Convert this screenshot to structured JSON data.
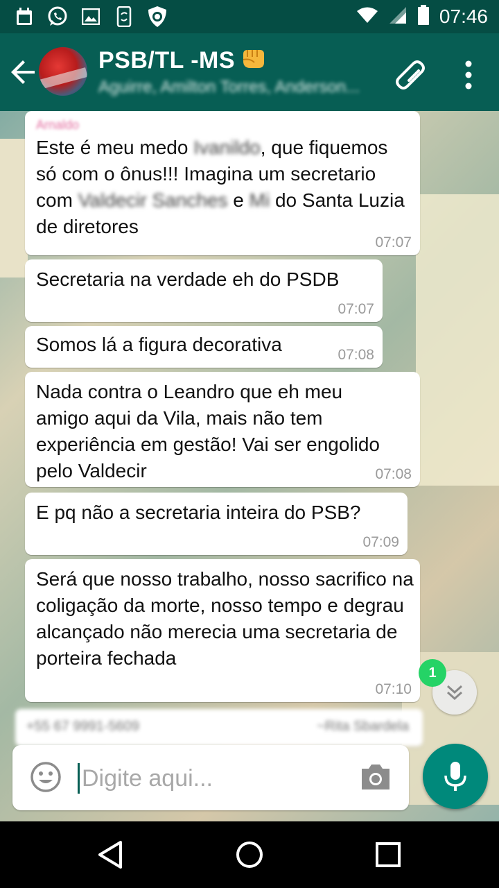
{
  "status_bar": {
    "time": "07:46",
    "icons": [
      "calendar-icon",
      "whatsapp-icon",
      "image-icon",
      "phone-sync-icon",
      "shield-icon",
      "wifi-icon",
      "signal-icon",
      "battery-icon"
    ]
  },
  "header": {
    "title": "PSB/TL -MS",
    "title_emoji": "fist-emoji",
    "subtitle": "Aguirre, Amilton Torres, Anderson...",
    "accent_color": "#075e54"
  },
  "messages": [
    {
      "sender": "Arnaldo",
      "parts": [
        "Este é meu medo ",
        "Ivanildo",
        ", que fiquemos só com o ônus!!! Imagina um secretario com ",
        "Valdecir Sanches",
        " e ",
        "Mi",
        " do Santa Luzia de diretores"
      ],
      "time": "07:07"
    },
    {
      "text": "Secretaria na verdade eh do PSDB",
      "time": "07:07"
    },
    {
      "text": "Somos lá a figura decorativa",
      "time": "07:08"
    },
    {
      "text": "Nada contra o Leandro que eh meu amigo aqui da Vila, mais não tem experiência em gestão! Vai ser engolido pelo Valdecir",
      "time": "07:08"
    },
    {
      "text": "E pq não a secretaria inteira do PSB?",
      "time": "07:09"
    },
    {
      "text": "Será que nosso trabalho, nosso sacrifico na coligação da morte, nosso tempo e degrau alcançado não merecia uma secretaria de porteira fechada",
      "time": "07:10"
    }
  ],
  "quoted_preview": {
    "left": "+55 67 9991-5609",
    "right": "~Rita Sbardela"
  },
  "unread_count": "1",
  "composer": {
    "placeholder": "Digite aqui..."
  },
  "colors": {
    "unread_badge": "#25d366",
    "mic_button": "#00897b",
    "bubble": "#ffffff",
    "timestamp": "#9a9a9a"
  }
}
